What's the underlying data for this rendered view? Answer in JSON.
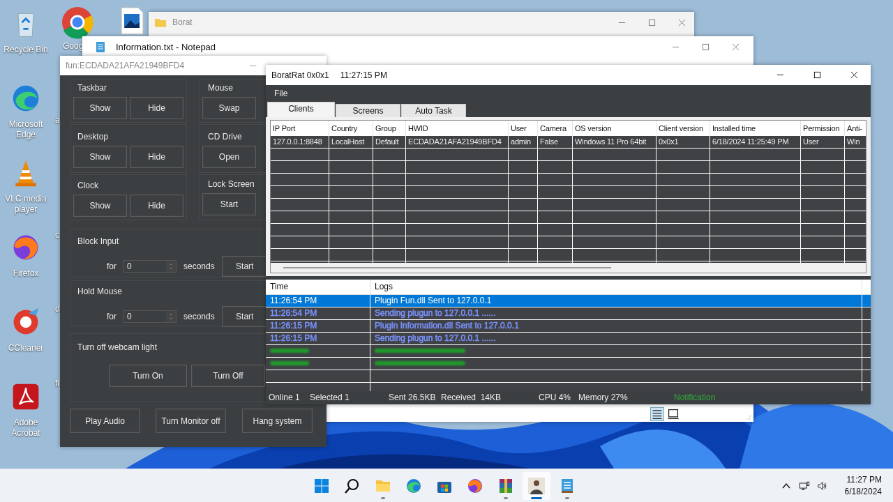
{
  "desktop_icons": [
    {
      "kind": "recycle",
      "label": "Recycle Bin"
    },
    {
      "kind": "edge",
      "label": "Microsoft Edge"
    },
    {
      "kind": "vlc",
      "label": "VLC media player"
    },
    {
      "kind": "firefox",
      "label": "Firefox"
    },
    {
      "kind": "ccleaner",
      "label": "CCleaner"
    },
    {
      "kind": "acrobat",
      "label": "Adobe Acrobat"
    }
  ],
  "desktop_icons_partial": [
    {
      "label": "Goog"
    },
    {
      "label": "a"
    },
    {
      "label": "c"
    },
    {
      "label": "d"
    },
    {
      "label": "fi"
    }
  ],
  "explorer_window": {
    "title": "Borat"
  },
  "notepad_window": {
    "title": "Information.txt - Notepad"
  },
  "fun_window": {
    "title": "fun:ECDADA21AFA21949BFD4",
    "left_groups": [
      {
        "label": "Taskbar",
        "buttons": [
          "Show",
          "Hide"
        ]
      },
      {
        "label": "Desktop",
        "buttons": [
          "Show",
          "Hide"
        ]
      },
      {
        "label": "Clock",
        "buttons": [
          "Show",
          "Hide"
        ]
      }
    ],
    "right_groups": [
      {
        "label": "Mouse",
        "buttons": [
          "Swap"
        ]
      },
      {
        "label": "CD Drive",
        "buttons": [
          "Open"
        ]
      },
      {
        "label": "Lock Screen",
        "buttons": [
          "Start"
        ]
      }
    ],
    "timed_groups": [
      {
        "label": "Block Input",
        "prefix": "for",
        "value": "0",
        "unit": "seconds",
        "button": "Start"
      },
      {
        "label": "Hold Mouse",
        "prefix": "for",
        "value": "0",
        "unit": "seconds",
        "button": "Start"
      }
    ],
    "webcam": {
      "label": "Turn off webcam light",
      "buttons": [
        "Turn On",
        "Turn Off"
      ]
    },
    "bottom_buttons": [
      "Play Audio",
      "Turn Monitor off",
      "Hang system"
    ]
  },
  "rat_window": {
    "title": "BoratRat 0x0x1",
    "time": "11:27:15 PM",
    "menu": [
      "File"
    ],
    "tabs": [
      {
        "label": "Clients",
        "selected": true
      },
      {
        "label": "Screens",
        "selected": false
      },
      {
        "label": "Auto Task",
        "selected": false
      }
    ],
    "clients": {
      "columns": [
        "IP Port",
        "Country",
        "Group",
        "HWID",
        "User",
        "Camera",
        "OS version",
        "Client version",
        "Installed time",
        "Permission",
        "Anti-"
      ],
      "rows": [
        [
          "127.0.0.1:8848",
          "LocalHost",
          "Default",
          "ECDADA21AFA21949BFD4",
          "admin",
          "False",
          "Windows 11 Pro 64bit",
          "0x0x1",
          "6/18/2024 11:25:49 PM",
          "User",
          "Win"
        ]
      ]
    },
    "logs": {
      "columns": [
        "Time",
        "Logs"
      ],
      "rows": [
        {
          "time": "11:26:54 PM",
          "text": "Plugin Fun.dll Sent to 127.0.0.1",
          "selected": true
        },
        {
          "time": "11:26:54 PM",
          "text": "Sending plugun to 127.0.0.1 ......",
          "color": "#7b93ff",
          "selected": false
        },
        {
          "time": "11:26:15 PM",
          "text": "Plugin Information.dll Sent to 127.0.0.1",
          "color": "#7b93ff",
          "selected": false
        },
        {
          "time": "11:26:15 PM",
          "text": "Sending plugun to 127.0.0.1 ......",
          "color": "#7b93ff",
          "selected": false
        },
        {
          "color": "#1e9e2a",
          "selected": false
        },
        {
          "color": "#1e9e2a",
          "selected": false
        }
      ]
    },
    "status": [
      "Online 1",
      "Selected 1",
      "Sent 26.5KB",
      "Received  14KB",
      "CPU 4%",
      "Memory 27%"
    ],
    "notification": "Notification"
  },
  "taskbar": {
    "apps": [
      {
        "kind": "start",
        "running": false,
        "selected": false
      },
      {
        "kind": "search",
        "running": false,
        "selected": false
      },
      {
        "kind": "explorer",
        "running": true,
        "selected": false
      },
      {
        "kind": "edge",
        "running": false,
        "selected": false
      },
      {
        "kind": "store",
        "running": false,
        "selected": false
      },
      {
        "kind": "firefox",
        "running": false,
        "selected": false
      },
      {
        "kind": "winrar",
        "running": true,
        "selected": false
      },
      {
        "kind": "person",
        "running": true,
        "selected": true
      },
      {
        "kind": "notepad",
        "running": true,
        "selected": false
      }
    ],
    "time": "11:27 PM",
    "date": "6/18/2024"
  }
}
